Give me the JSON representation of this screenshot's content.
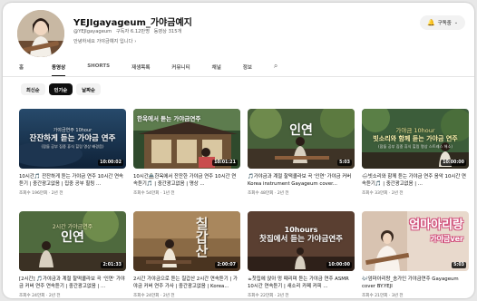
{
  "channel": {
    "name": "YEJIgayageum_가야금예지",
    "handle": "@YEJIgayageum",
    "subscribers": "구독자 6.12만명",
    "videos": "동영상 315개",
    "description": "안녕하세요 가야금예지 입니다",
    "description_more": "›",
    "subscribe_label": "구독중",
    "bell_icon": "🔔",
    "dropdown_icon": "⌄"
  },
  "tabs": [
    {
      "label": "홈"
    },
    {
      "label": "동영상"
    },
    {
      "label": "SHORTS"
    },
    {
      "label": "재생목록"
    },
    {
      "label": "커뮤니티"
    },
    {
      "label": "채널"
    },
    {
      "label": "정보"
    }
  ],
  "search_icon": "⌕",
  "chips": [
    {
      "label": "최신순"
    },
    {
      "label": "인기순"
    },
    {
      "label": "날짜순"
    }
  ],
  "videos": [
    {
      "thumb_text": [
        "가야금연주 10hour",
        "잔잔하게 듣는 가야금 연주",
        "(잠들 공부 집중 휴식 힐링 명상 배경음)"
      ],
      "duration": "10:00:02",
      "title": "10시간🎵 잔잔하게 듣는 가야금 연주 10시간 연속듣기 | 중간광고없음 | 집중 공부 힐링 ...",
      "meta": "조회수 196만회 · 2년 전"
    },
    {
      "thumb_text": [
        "",
        "한옥에서 듣는 가야금연주",
        ""
      ],
      "duration": "10:01:21",
      "title": "10시간🏯한옥에서 잔잔한 가야금 연주 10시간 연속듣기🎵 | 중간광고없음 | 명상 ...",
      "meta": "조회수 54만회 · 1년 전"
    },
    {
      "thumb_text": [
        "",
        "인연",
        ""
      ],
      "duration": "5:03",
      "title": "🎵가야금과 계절 찰떡콜라보 곡 '인연' 가야금 커버 Korea instrument Gayageum cover...",
      "meta": "조회수 48만회 · 2년 전"
    },
    {
      "thumb_text": [
        "가야금 10hour",
        "빗소리와 함께 듣는 가야금 연주",
        "(잠들 공부 집중 휴식 힐링 명상 스트레스 해소)"
      ],
      "duration": "10:00:00",
      "title": "🌧빗소리와 함께 듣는 가야금 연주 음악 10시간 연속듣기🎵 | 중간광고없음 | ...",
      "meta": "조회수 33만회 · 2년 전"
    },
    {
      "thumb_text": [
        "2시간 가야금연주",
        "인연",
        ""
      ],
      "duration": "2:01:33",
      "title": "[2시간] 🎵가야금과 계절 찰떡콜라보 곡 '인연' 가야금 커버 연주 연속듣기 | 중간광고없음 | ...",
      "meta": "조회수 24만회 · 2년 전"
    },
    {
      "thumb_text": [
        "",
        "칠갑산",
        ""
      ],
      "duration": "2:00:07",
      "title": "2시간 가야금으로 듣는 칠갑산 2시간 연속듣기 | 가야금 커버 연주 가사 | 중간광고없음 | Korea...",
      "meta": "조회수 24만회 · 2년 전"
    },
    {
      "thumb_text": [
        "10hours",
        "찻집에서 듣는 가야금연주",
        ""
      ],
      "duration": "10:00:00",
      "title": "☕찻집에 앉아 멍 때리며 듣는 가야금 연주 ASMR 10시간 연속듣기 | 새소리 카페 커피 ...",
      "meta": "조회수 22만회 · 2년 전"
    },
    {
      "thumb_text": [
        "엄마아리랑",
        "가야금ver",
        ""
      ],
      "duration": "5:03",
      "title": "🎶엄마아리랑_송가인 가야금연주 Gayageum cover BY.YEJI",
      "meta": "조회수 21만회 · 3년 전"
    }
  ]
}
